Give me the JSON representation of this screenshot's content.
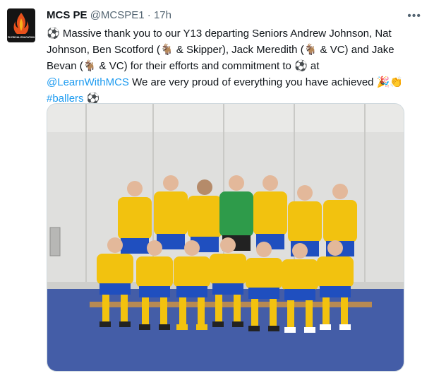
{
  "account": {
    "display_name": "MCS PE",
    "handle": "@MCSPE1",
    "separator": "·",
    "timestamp": "17h",
    "avatar_text": "PHYSICAL EDUCATION"
  },
  "menu_icon": "more-horizontal-icon",
  "tweet": {
    "part1": "Massive thank you to our Y13 departing Seniors Andrew Johnson, Nat Johnson, Ben Scotford (",
    "part2": " & Skipper), Jack Meredith (",
    "part3": " & VC) and Jake Bevan (",
    "part4": " & VC) for their efforts and commitment to ",
    "part5": " at",
    "mention": "@LearnWithMCS",
    "part6": " We are very proud of everything you have achieved ",
    "hashtag": "#ballers",
    "soccer_emoji": "⚽",
    "goat_emoji": "🐐",
    "party_emoji": "🎉",
    "clap_emoji": "👏"
  },
  "colors": {
    "link": "#1d9bf0",
    "meta": "#536471",
    "kit_yellow": "#f2c20f",
    "kit_blue": "#1f4fbf",
    "keeper_green": "#2e9b4a"
  }
}
